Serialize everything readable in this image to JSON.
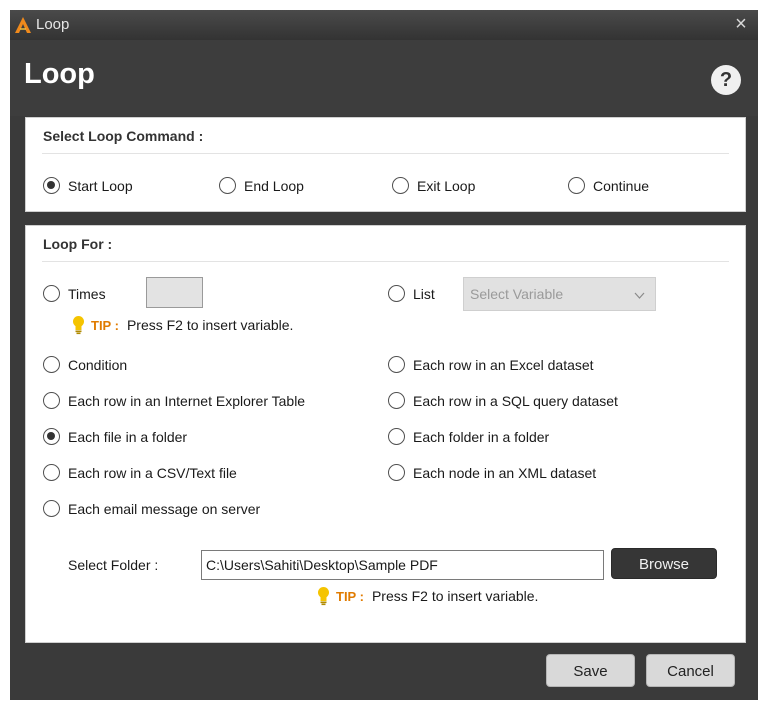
{
  "window": {
    "title": "Loop",
    "icon": "app-logo-icon",
    "close_glyph": "×"
  },
  "header": {
    "title": "Loop",
    "help_glyph": "?"
  },
  "loop_command": {
    "title": "Select Loop Command :",
    "options": [
      {
        "label": "Start Loop",
        "checked": true
      },
      {
        "label": "End Loop",
        "checked": false
      },
      {
        "label": "Exit Loop",
        "checked": false
      },
      {
        "label": "Continue",
        "checked": false
      }
    ]
  },
  "loop_for": {
    "title": "Loop For :",
    "times_label": "Times",
    "times_value": "",
    "list_label": "List",
    "list_placeholder": "Select Variable",
    "tip_label": "TIP :",
    "tip_text": "Press F2 to insert variable.",
    "options": [
      {
        "label": "Condition",
        "checked": false
      },
      {
        "label": "Each row in an Excel dataset",
        "checked": false
      },
      {
        "label": "Each row in an Internet Explorer Table",
        "checked": false
      },
      {
        "label": "Each row in a SQL query dataset",
        "checked": false
      },
      {
        "label": "Each file in a folder",
        "checked": true
      },
      {
        "label": "Each folder in a folder",
        "checked": false
      },
      {
        "label": "Each row in a CSV/Text file",
        "checked": false
      },
      {
        "label": "Each node in an XML dataset",
        "checked": false
      },
      {
        "label": "Each email message on server",
        "checked": false
      }
    ],
    "folder_label": "Select Folder :",
    "folder_value": "C:\\Users\\Sahiti\\Desktop\\Sample PDF",
    "browse_label": "Browse",
    "tip2_label": "TIP :",
    "tip2_text": "Press F2 to insert variable."
  },
  "footer": {
    "save_label": "Save",
    "cancel_label": "Cancel"
  },
  "colors": {
    "window_bg": "#3a3a3a",
    "tip_accent": "#e07b00",
    "bulb": "#f5c400"
  }
}
